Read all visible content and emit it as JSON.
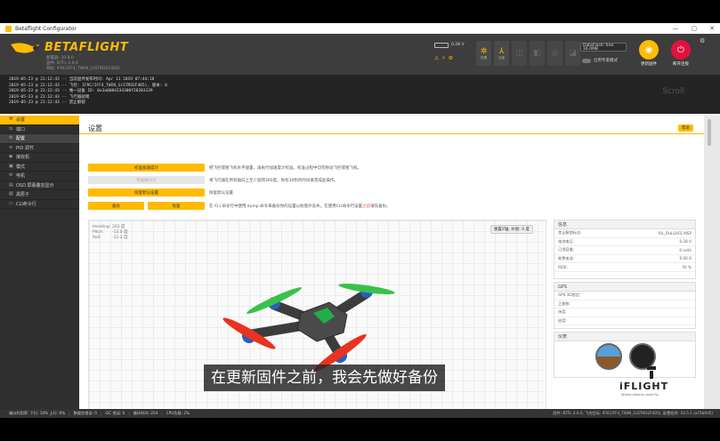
{
  "window": {
    "title": "Betaflight Configurator",
    "controls": [
      "—",
      "▢",
      "✕"
    ]
  },
  "header": {
    "logo_text": "BETAFLIGHT",
    "logo_sub1": "配置器: 10.8.0",
    "logo_sub2": "固件: BTFL 4.0.0",
    "logo_sub3": "目标: IFRC/IFF4_TWIN_G(STM32F405)",
    "battery": "0.28 V",
    "sensors": [
      {
        "icon": "gyro-icon",
        "label": "陀螺"
      },
      {
        "icon": "accel-icon",
        "label": "加速"
      },
      {
        "icon": "mag-icon",
        "label": ""
      },
      {
        "icon": "baro-icon",
        "label": ""
      },
      {
        "icon": "gps-icon",
        "label": ""
      },
      {
        "icon": "sonar-icon",
        "label": ""
      }
    ],
    "port_value": "DataFlash: free",
    "port_value2": "16.0MB",
    "toggle_label": "启用专家模式",
    "update_firmware_label": "更新固件",
    "disconnect_label": "断开连接",
    "colors": {
      "accent": "#ffbb00",
      "disconnect": "#e2123f"
    }
  },
  "log": {
    "lines": [
      "2019-05-23 @ 21:12:43 -- 当前固件发布时间: Apr 11 2019 07:44:18",
      "2019-05-23 @ 21:12:43 -- 飞控: IFRC/IFF4_TWIN_G(STM32F405), 版本: 0",
      "2019-05-23 @ 21:12:43 -- 唯一设备 ID: 0x3a0084234300f20203139",
      "2019-05-23 @ 21:12:43 -- 飞行器就绪",
      "2019-05-23 @ 21:12:43 -- 禁止解锁"
    ],
    "scroll_label": "Scroll"
  },
  "sidebar": {
    "items": [
      {
        "icon": "wrench-icon",
        "glyph": "⚒",
        "label": "设置"
      },
      {
        "icon": "plug-icon",
        "glyph": "⇆",
        "label": "端口"
      },
      {
        "icon": "gear-icon",
        "glyph": "⚙",
        "label": "配置"
      },
      {
        "icon": "pid-icon",
        "glyph": "≋",
        "label": "PID 调节"
      },
      {
        "icon": "receiver-icon",
        "glyph": "◉",
        "label": "接收机"
      },
      {
        "icon": "modes-icon",
        "glyph": "▣",
        "label": "模式"
      },
      {
        "icon": "motor-icon",
        "glyph": "✣",
        "label": "电机"
      },
      {
        "icon": "osd-icon",
        "glyph": "▤",
        "label": "OSD 屏幕叠加显示"
      },
      {
        "icon": "blackbox-icon",
        "glyph": "▧",
        "label": "黑匣子"
      },
      {
        "icon": "cli-icon",
        "glyph": "▭",
        "label": "CLI命令行"
      }
    ]
  },
  "main": {
    "title": "设置",
    "wiki_label": "帮助",
    "actions": [
      {
        "label": "校准加速度计",
        "desc": "把飞控或者飞机水平放置，再执行加速度计校准，校准过程中切勿移动飞控或者飞机。",
        "disabled": false
      },
      {
        "label": "校准磁力计",
        "desc": "将飞行器在所有轴向上至少旋转360度，你有30秒的时间来完成此操作。",
        "disabled": true
      },
      {
        "label": "恢复默认设置",
        "desc": "恢复默认设置",
        "disabled": false
      }
    ],
    "backup_label": "备份",
    "restore_label": "恢复",
    "backup_desc_a": "在 CLI 命令行中使用 dump 命令来备份你的设置以防意外丢失，在使用CLI命令行设置",
    "backup_desc_red": "之前",
    "backup_desc_b": "请先备份。",
    "attitude": {
      "heading_label": "Heading:",
      "heading_value": "202 度",
      "pitch_label": "Pitch:",
      "pitch_value": "-13.0 度",
      "roll_label": "Roll:",
      "roll_value": "-12.2 度"
    },
    "reset_z_label": "重置Z轴, 补偿: 0 度"
  },
  "info_panel": {
    "title": "信息",
    "rows": [
      {
        "k": "禁止解锁标志:",
        "v": "RX_FAILSAFE MSP"
      },
      {
        "k": "电池电压:",
        "v": "0.28 V"
      },
      {
        "k": "已用容量:",
        "v": "0 mAh"
      },
      {
        "k": "耗费电流:",
        "v": "0.00 A"
      },
      {
        "k": "RSSI:",
        "v": "50 %"
      }
    ]
  },
  "gps_panel": {
    "title": "GPS",
    "rows": [
      {
        "k": "GPS 3D锁定:",
        "v": ""
      },
      {
        "k": "卫星数:",
        "v": ""
      },
      {
        "k": "纬度:",
        "v": ""
      },
      {
        "k": "经度:",
        "v": ""
      }
    ]
  },
  "instruments_panel": {
    "title": "仪表"
  },
  "statusbar": {
    "items": [
      "端口利用率: 下行: 10% 上行: 0%",
      "数据包错误: 0",
      "I2C 错误: 0",
      "循环时间: 254",
      "CPU负载: 2%"
    ],
    "right": "固件: BTFL 4.0.0, 飞控目标: IFRC/IFF4_TWIN_G(STM32F405), 配置程序: 10.5.1 (a75b0d5)"
  },
  "subtitle": "在更新固件之前，我会先做好备份",
  "watermark": {
    "word": "iFLIGHT",
    "tag": "Where dreams come fly"
  }
}
